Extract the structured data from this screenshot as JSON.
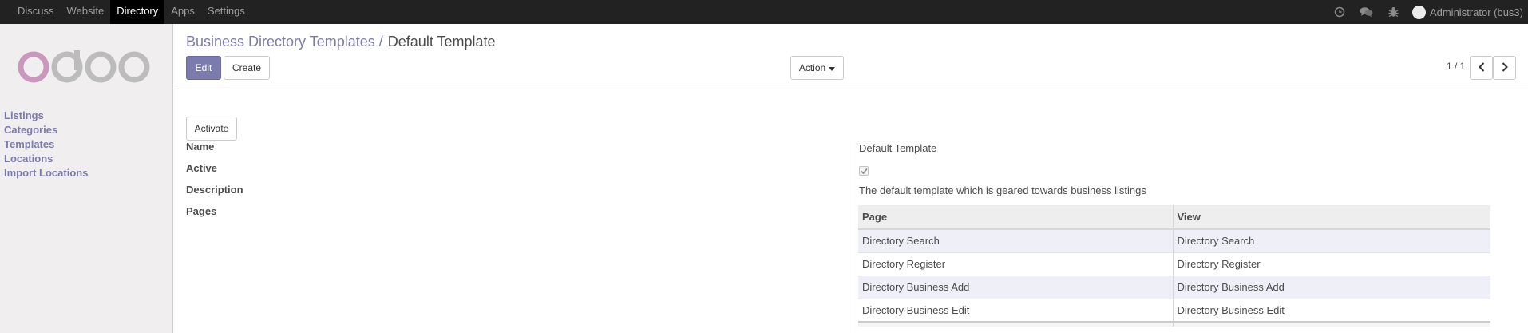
{
  "topbar": {
    "menu": [
      "Discuss",
      "Website",
      "Directory",
      "Apps",
      "Settings"
    ],
    "active": "Directory",
    "user": "Administrator (bus3)"
  },
  "sidebar": {
    "logo": "odoo",
    "items": [
      "Listings",
      "Categories",
      "Templates",
      "Locations",
      "Import Locations"
    ]
  },
  "control_panel": {
    "breadcrumb_parent": "Business Directory Templates",
    "breadcrumb_separator": "/",
    "breadcrumb_current": "Default Template",
    "edit_label": "Edit",
    "create_label": "Create",
    "action_label": "Action",
    "pager_value": "1 / 1"
  },
  "form": {
    "activate_label": "Activate",
    "labels": {
      "name": "Name",
      "active": "Active",
      "description": "Description",
      "pages": "Pages"
    },
    "name_value": "Default Template",
    "active_value": true,
    "description_value": "The default template which is geared towards business listings",
    "pages_table": {
      "headers": [
        "Page",
        "View"
      ],
      "rows": [
        [
          "Directory Search",
          "Directory Search"
        ],
        [
          "Directory Register",
          "Directory Register"
        ],
        [
          "Directory Business Add",
          "Directory Business Add"
        ],
        [
          "Directory Business Edit",
          "Directory Business Edit"
        ]
      ]
    }
  },
  "colors": {
    "accent": "#7c7bad",
    "topbar": "#222222",
    "sidebar": "#f0eeee"
  }
}
